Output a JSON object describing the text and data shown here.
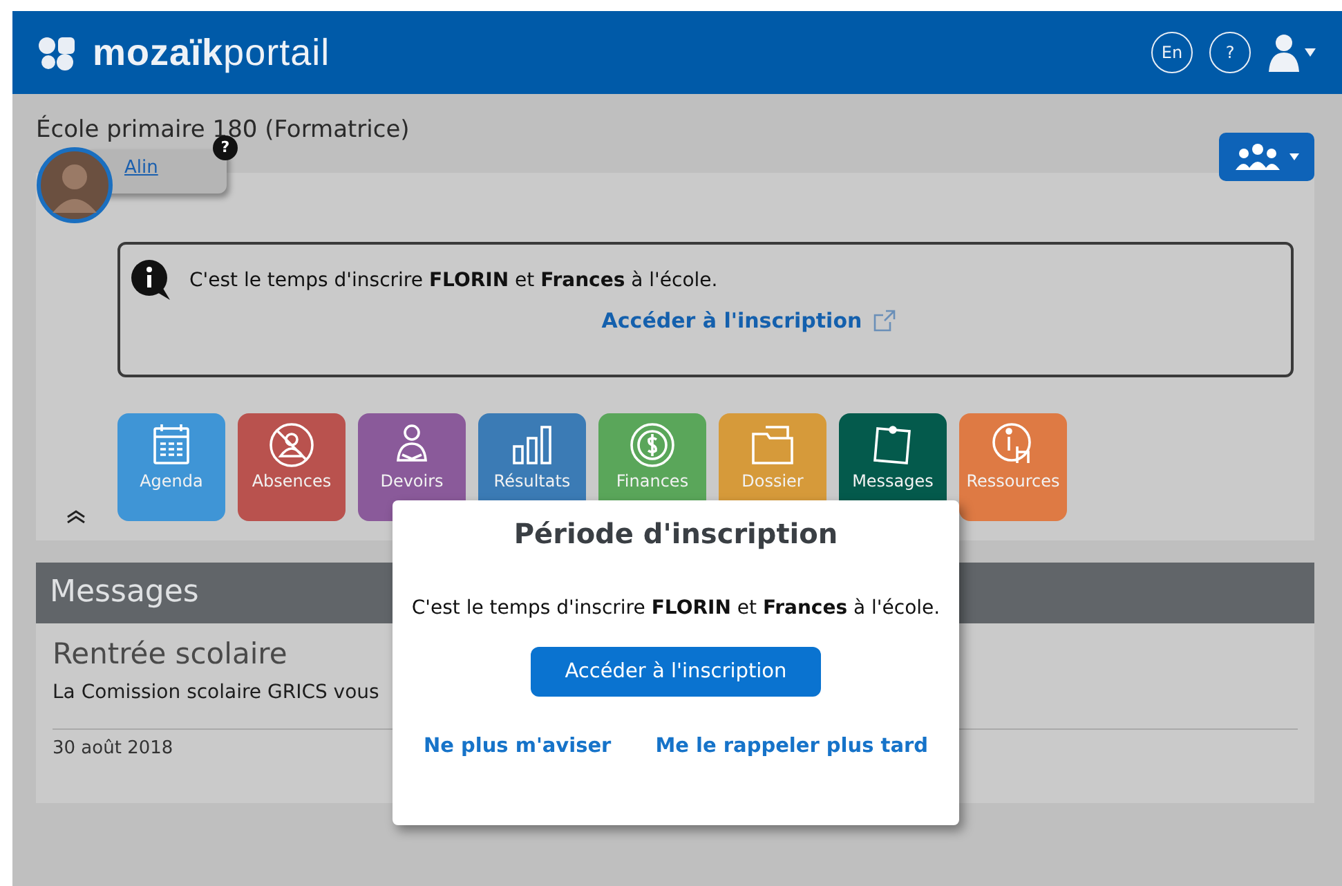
{
  "header": {
    "logo": {
      "bold": "mozaïk",
      "light": "portail"
    },
    "language": "En",
    "help": "?"
  },
  "school_title": "École primaire 180 (Formatrice)",
  "user": {
    "name": "Alin",
    "help_badge": "?"
  },
  "info_banner": {
    "text": "C'est le temps d'inscrire **FLORIN** et **Frances** à l'école.",
    "link": "Accéder à l'inscription"
  },
  "tiles": [
    {
      "label": "Agenda",
      "kind": "calendar",
      "color": "#3f95d6"
    },
    {
      "label": "Absences",
      "kind": "absence",
      "color": "#b9524e"
    },
    {
      "label": "Devoirs",
      "kind": "homework",
      "color": "#8a5a9a"
    },
    {
      "label": "Résultats",
      "kind": "results",
      "color": "#3b7bb5"
    },
    {
      "label": "Finances",
      "kind": "finances",
      "color": "#5aa65a"
    },
    {
      "label": "Dossier",
      "kind": "folder",
      "color": "#d69a3a"
    },
    {
      "label": "Messages",
      "kind": "messages",
      "color": "#045a4c"
    },
    {
      "label": "Ressources",
      "kind": "resources",
      "color": "#de7a44"
    }
  ],
  "messages": {
    "title": "Messages",
    "items": [
      {
        "title": "Rentrée scolaire",
        "text": "La Comission scolaire GRICS vous",
        "date": "30 août 2018"
      }
    ]
  },
  "dialog": {
    "title": "Période d'inscription",
    "text": "C'est le temps d'inscrire **FLORIN** et **Frances** à l'école.",
    "primary_button": "Accéder à l'inscription",
    "links": [
      "Ne plus m'aviser",
      "Me le rappeler plus tard"
    ]
  }
}
